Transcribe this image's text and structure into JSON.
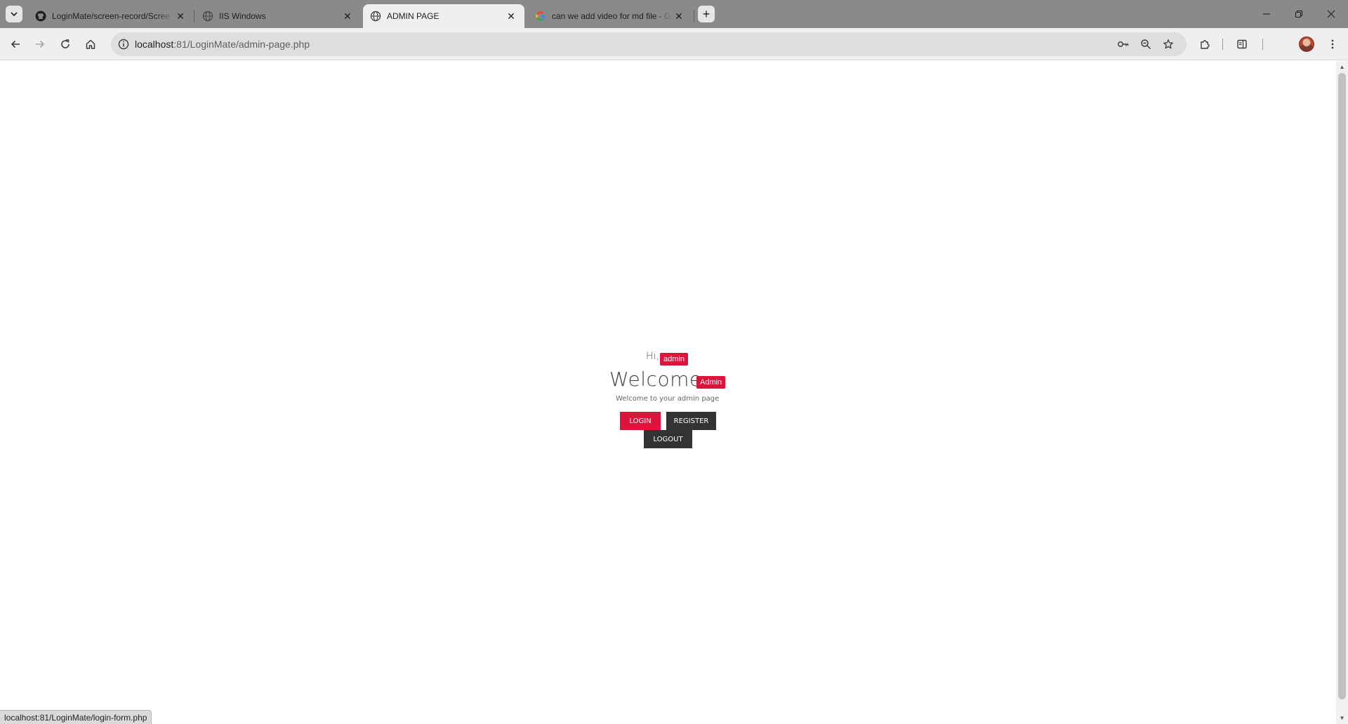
{
  "browser": {
    "tabs": [
      {
        "title": "LoginMate/screen-record/Scree",
        "icon": "github-icon",
        "active": false
      },
      {
        "title": "IIS Windows",
        "icon": "globe-icon",
        "active": false
      },
      {
        "title": "ADMIN PAGE",
        "icon": "globe-icon",
        "active": true
      },
      {
        "title": "can we add video for md file - G",
        "icon": "google-icon",
        "active": false
      }
    ],
    "new_tab_symbol": "+",
    "url_host": "localhost",
    "url_rest": ":81/LoginMate/admin-page.php",
    "status_url": "localhost:81/LoginMate/login-form.php"
  },
  "page": {
    "greeting": "Hi,",
    "username": "admin",
    "heading": "Welcome",
    "role_badge": "Admin",
    "subtitle": "Welcome to your admin page",
    "buttons": {
      "login": "LOGIN",
      "register": "REGISTER",
      "logout": "LOGOUT"
    }
  },
  "colors": {
    "accent": "#dc143c",
    "dark_button": "#333333",
    "tabstrip": "#8a8a8a",
    "toolbar": "#efefef"
  }
}
